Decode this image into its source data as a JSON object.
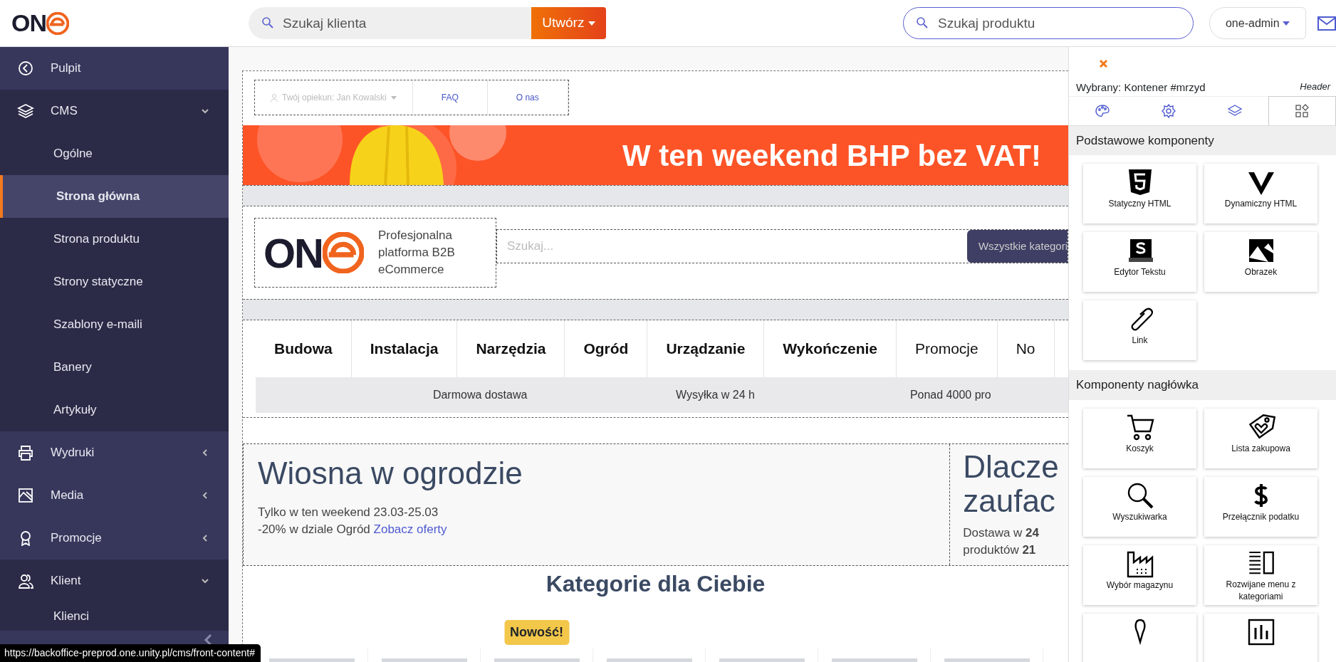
{
  "topbar": {
    "logo": "ON",
    "client_search": {
      "placeholder": "Szukaj klienta"
    },
    "create_button": "Utwórz",
    "product_search": {
      "placeholder": "Szukaj produktu"
    },
    "user_menu": "one-admin"
  },
  "sidebar": {
    "items": [
      {
        "label": "Pulpit",
        "selected": false
      },
      {
        "label": "CMS",
        "selected": false,
        "expanded": true,
        "children": [
          {
            "label": "Ogólne",
            "selected": false
          },
          {
            "label": "Strona główna",
            "selected": true
          },
          {
            "label": "Strona produktu",
            "selected": false
          },
          {
            "label": "Strony statyczne",
            "selected": false
          },
          {
            "label": "Szablony e-maili",
            "selected": false
          },
          {
            "label": "Banery",
            "selected": false
          },
          {
            "label": "Artykuły",
            "selected": false
          }
        ]
      },
      {
        "label": "Wydruki",
        "selected": false,
        "expanded": false
      },
      {
        "label": "Media",
        "selected": false,
        "expanded": false
      },
      {
        "label": "Promocje",
        "selected": false,
        "expanded": false
      },
      {
        "label": "Klient",
        "selected": false,
        "expanded": true,
        "children": [
          {
            "label": "Klienci",
            "selected": false
          }
        ]
      }
    ]
  },
  "preview": {
    "top_links": {
      "caretaker": "Twój opiekun: Jan Kowalski",
      "links": [
        "FAQ",
        "O nas"
      ]
    },
    "banner": {
      "text": "W ten weekend BHP bez VAT!"
    },
    "store_header": {
      "logo": "ON",
      "tagline": "Profesjonalna platforma B2B eCommerce",
      "search": {
        "placeholder": "Szukaj..."
      },
      "category_button": "Wszystkie kategori"
    },
    "categories": [
      {
        "label": "Budowa",
        "bold": true
      },
      {
        "label": "Instalacja",
        "bold": true
      },
      {
        "label": "Narzędzia",
        "bold": true
      },
      {
        "label": "Ogród",
        "bold": true
      },
      {
        "label": "Urządzanie",
        "bold": true
      },
      {
        "label": "Wykończenie",
        "bold": true
      },
      {
        "label": "Promocje",
        "bold": false
      },
      {
        "label": "No",
        "bold": false
      }
    ],
    "benefits": [
      "Darmowa dostawa",
      "Wysyłka w 24 h",
      "Ponad 4000 pro"
    ],
    "promo": {
      "title": "Wiosna w ogrodzie",
      "lines": [
        "Tylko w ten weekend 23.03-25.03",
        "-20% w dziale Ogród"
      ],
      "link": "Zobacz oferty"
    },
    "why": {
      "title_lines": [
        "Dlacze",
        "zaufac"
      ],
      "lines": [
        "Dostawa w **24**",
        "produktów **21**"
      ]
    },
    "categories_heading": "Kategorie dla Ciebie",
    "products": [
      {
        "kind": "photo"
      },
      {
        "kind": "photo"
      },
      {
        "kind": "photo",
        "badge": "Nowość!"
      },
      {
        "kind": "photo"
      },
      {
        "kind": "photo"
      },
      {
        "kind": "photo"
      },
      {
        "kind": "photo"
      }
    ]
  },
  "panel": {
    "selected_label": "Wybrany: Kontener #mrzyd",
    "context": "Header",
    "tabs": [
      {
        "selected": false
      },
      {
        "selected": false
      },
      {
        "selected": false
      },
      {
        "selected": true
      }
    ],
    "sections": [
      {
        "title": "Podstawowe komponenty",
        "components": [
          {
            "kind": "tile",
            "label": "Statyczny HTML"
          },
          {
            "kind": "tile",
            "label": "Dynamiczny HTML"
          },
          {
            "kind": "tile",
            "label": "Edytor Tekstu"
          },
          {
            "kind": "tile",
            "label": "Obrazek"
          },
          {
            "kind": "tile",
            "label": "Link"
          }
        ]
      },
      {
        "title": "Komponenty nagłówka",
        "components": [
          {
            "kind": "tile",
            "label": "Koszyk"
          },
          {
            "kind": "tile",
            "label": "Lista zakupowa"
          },
          {
            "kind": "tile",
            "label": "Wyszukiwarka"
          },
          {
            "kind": "tile",
            "label": "Przełącznik podatku"
          },
          {
            "kind": "tile",
            "label": "Wybór magazynu"
          },
          {
            "kind": "tile",
            "label": "Rozwijane menu z kategoriami"
          },
          {
            "kind": "tile"
          },
          {
            "kind": "tile"
          }
        ]
      }
    ]
  },
  "status_bar": "https://backoffice-preprod.one.unity.pl/cms/front-content#"
}
